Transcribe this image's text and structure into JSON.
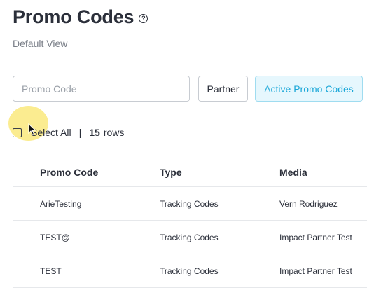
{
  "header": {
    "title": "Promo Codes",
    "help_icon": "question-circle-icon",
    "subtitle": "Default View"
  },
  "filters": {
    "promo_code_placeholder": "Promo Code",
    "promo_code_value": "",
    "partner_label": "Partner",
    "active_label": "Active Promo Codes"
  },
  "selection": {
    "select_all_label": "Select All",
    "separator": "|",
    "rows_count": "15",
    "rows_suffix": "rows"
  },
  "table": {
    "columns": [
      "Promo Code",
      "Type",
      "Media"
    ],
    "rows": [
      [
        "ArieTesting",
        "Tracking Codes",
        "Vern Rodriguez"
      ],
      [
        "TEST@",
        "Tracking Codes",
        "Impact Partner Test"
      ],
      [
        "TEST",
        "Tracking Codes",
        "Impact Partner Test"
      ]
    ]
  },
  "colors": {
    "accent": "#1aa7d8",
    "accent_bg": "#e6f7fd",
    "text": "#2b2f3a",
    "muted": "#7a7f88",
    "cursor_highlight": "#fae878"
  }
}
